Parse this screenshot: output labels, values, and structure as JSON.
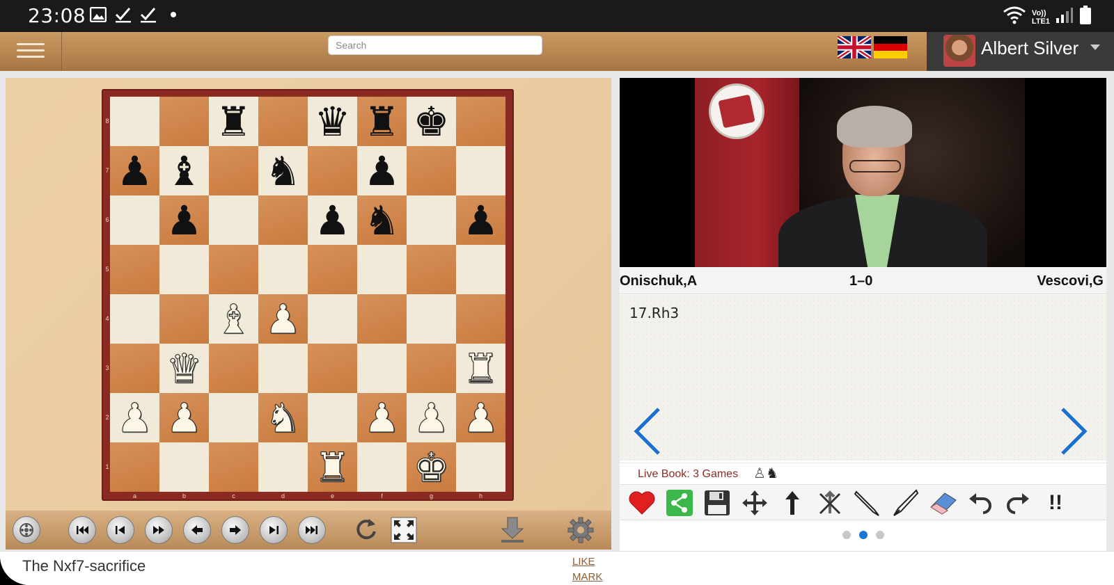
{
  "status_bar": {
    "time": "23:08",
    "icons": [
      "image-icon",
      "check-icon",
      "check-icon",
      "dot-icon"
    ],
    "right_icons": [
      "wifi-icon",
      "volte-icon",
      "signal-icon",
      "battery-icon"
    ],
    "volte_label_top": "Vo))",
    "volte_label_bottom": "LTE1"
  },
  "header": {
    "search_placeholder": "Search",
    "flags": [
      "uk-flag-icon",
      "germany-flag-icon"
    ],
    "user_name": "Albert Silver"
  },
  "board": {
    "ranks": [
      "8",
      "7",
      "6",
      "5",
      "4",
      "3",
      "2",
      "1"
    ],
    "files": [
      "a",
      "b",
      "c",
      "d",
      "e",
      "f",
      "g",
      "h"
    ],
    "position": [
      [
        "",
        "",
        "br",
        "",
        "bq",
        "br",
        "bk",
        ""
      ],
      [
        "bp",
        "bb",
        "",
        "bn",
        "",
        "bp",
        "",
        ""
      ],
      [
        "",
        "bp",
        "",
        "",
        "bp",
        "bn",
        "",
        "bp"
      ],
      [
        "",
        "",
        "",
        "",
        "",
        "",
        "",
        ""
      ],
      [
        "",
        "",
        "wb",
        "wp",
        "",
        "",
        "",
        ""
      ],
      [
        "",
        "wq",
        "",
        "",
        "",
        "",
        "",
        "wr"
      ],
      [
        "wp",
        "wp",
        "",
        "wn",
        "",
        "wp",
        "wp",
        "wp"
      ],
      [
        "",
        "",
        "",
        "",
        "wr",
        "",
        "wk",
        ""
      ]
    ],
    "controls": [
      "engine-icon",
      "first-move-icon",
      "previous-move-icon",
      "play-icon",
      "back-icon",
      "forward-icon",
      "next-move-icon",
      "last-move-icon",
      "flip-board-icon",
      "fullscreen-icon",
      "download-icon",
      "settings-icon"
    ]
  },
  "game": {
    "white": "Onischuk,A",
    "result": "1–0",
    "black": "Vescovi,G",
    "current_move": "17.Rh3"
  },
  "livebook": {
    "label": "Live Book: 3 Games"
  },
  "toolbar": {
    "tools": [
      "heart-icon",
      "share-icon",
      "save-icon",
      "move-icon",
      "up-arrow-icon",
      "delete-variation-icon",
      "pen-icon",
      "quill-icon",
      "eraser-icon",
      "undo-icon",
      "redo-icon",
      "annotation-icon"
    ],
    "annotation_label": "!!"
  },
  "pager": {
    "count": 3,
    "active": 1
  },
  "footer": {
    "caption": "The Nxf7-sacrifice",
    "like_label": "LIKE",
    "mark_label": "MARK"
  }
}
